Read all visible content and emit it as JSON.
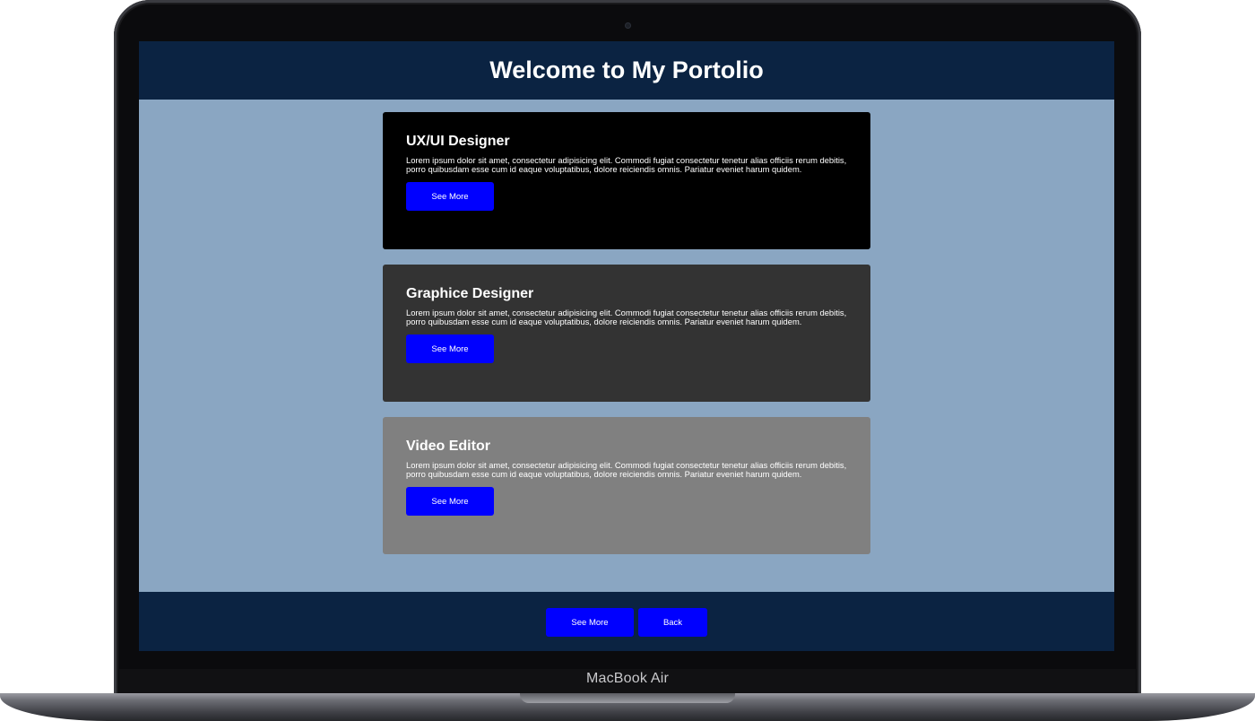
{
  "device": {
    "label": "MacBook Air"
  },
  "header": {
    "title": "Welcome to My Portolio"
  },
  "cards": [
    {
      "title": "UX/UI Designer",
      "text": "Lorem ipsum dolor sit amet, consectetur adipisicing elit. Commodi fugiat consectetur tenetur alias officiis rerum debitis, porro quibusdam esse cum id eaque voluptatibus, dolore reiciendis omnis. Pariatur eveniet harum quidem.",
      "button": "See More",
      "background": "#000000"
    },
    {
      "title": "Graphice Designer",
      "text": "Lorem ipsum dolor sit amet, consectetur adipisicing elit. Commodi fugiat consectetur tenetur alias officiis rerum debitis, porro quibusdam esse cum id eaque voluptatibus, dolore reiciendis omnis. Pariatur eveniet harum quidem.",
      "button": "See More",
      "background": "#333333"
    },
    {
      "title": "Video Editor",
      "text": "Lorem ipsum dolor sit amet, consectetur adipisicing elit. Commodi fugiat consectetur tenetur alias officiis rerum debitis, porro quibusdam esse cum id eaque voluptatibus, dolore reiciendis omnis. Pariatur eveniet harum quidem.",
      "button": "See More",
      "background": "#808080"
    }
  ],
  "footer": {
    "see_more": "See More",
    "back": "Back"
  },
  "colors": {
    "page_background": "#8aa6c2",
    "header_footer": "#0b2342",
    "button": "#0000ff"
  }
}
